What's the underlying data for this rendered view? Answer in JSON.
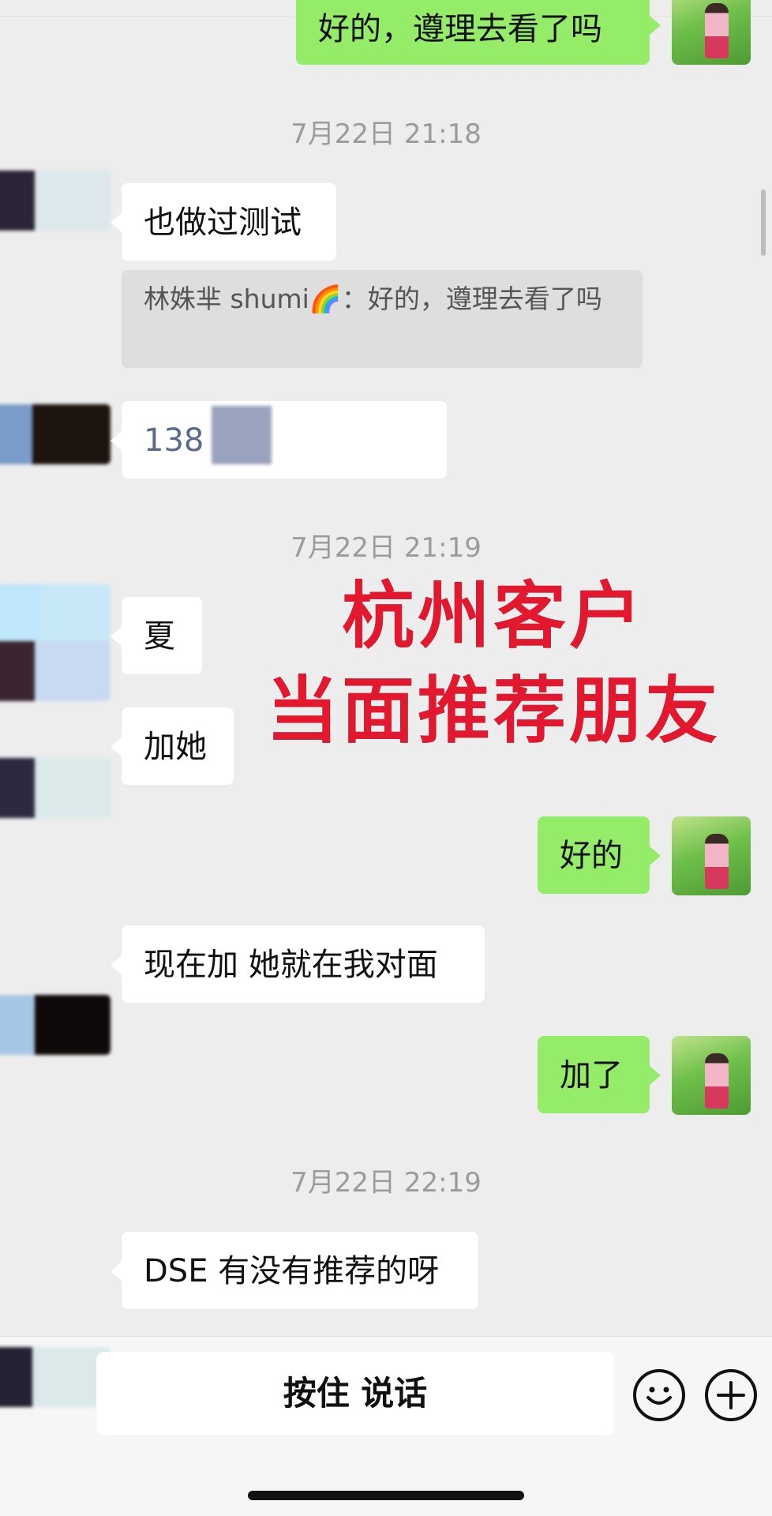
{
  "messages": {
    "m0_text": "好的，遵理去看了吗",
    "t1": "7月22日 21:18",
    "m1_text": "也做过测试",
    "m1_quote": "林姝芈 shumi🌈：好的，遵理去看了吗",
    "m2_text": "138",
    "t2": "7月22日 21:19",
    "m3_text": "夏",
    "m4_text": "加她",
    "m5_text": "好的",
    "m6_text": "现在加 她就在我对面",
    "m7_text": "加了",
    "t3": "7月22日 22:19",
    "m8_text": "DSE 有没有推荐的呀"
  },
  "overlay": {
    "line1": "杭州客户",
    "line2": "当面推荐朋友",
    "color": "#e2192e"
  },
  "input_bar": {
    "voice_label": "按住 说话",
    "emoji_icon": "smiley-icon",
    "plus_icon": "plus-circle-icon"
  },
  "colors": {
    "self_bubble": "#95ec69",
    "other_bubble": "#ffffff",
    "background": "#ededed"
  }
}
